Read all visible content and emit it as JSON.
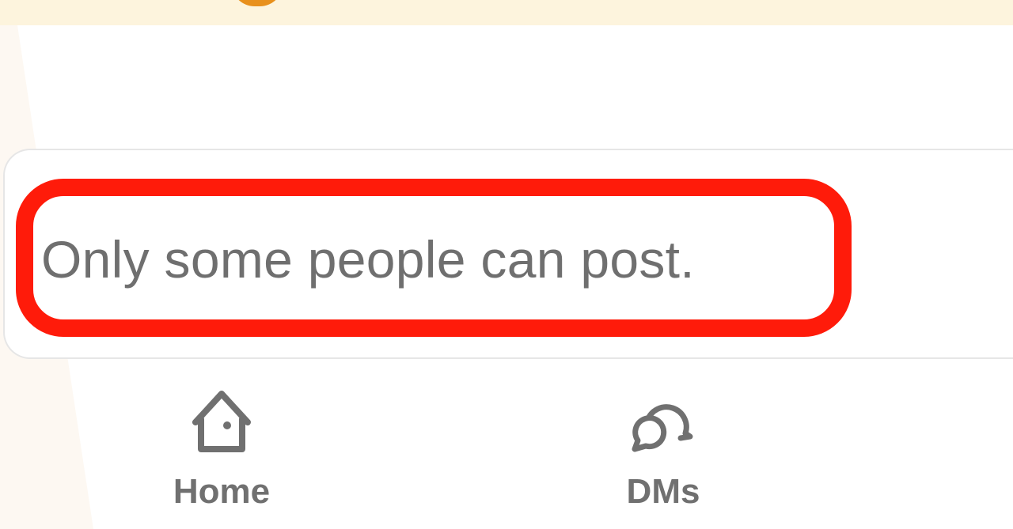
{
  "composer": {
    "notice": "Only some people can post."
  },
  "bottom_nav": {
    "items": [
      {
        "label": "Home",
        "icon": "home-icon"
      },
      {
        "label": "DMs",
        "icon": "dms-icon"
      }
    ]
  },
  "colors": {
    "banner_bg": "#fdf4dd",
    "banner_accent": "#e8901c",
    "highlight": "#ff1b0a",
    "text": "#6f6f6f",
    "icon": "#707070"
  }
}
